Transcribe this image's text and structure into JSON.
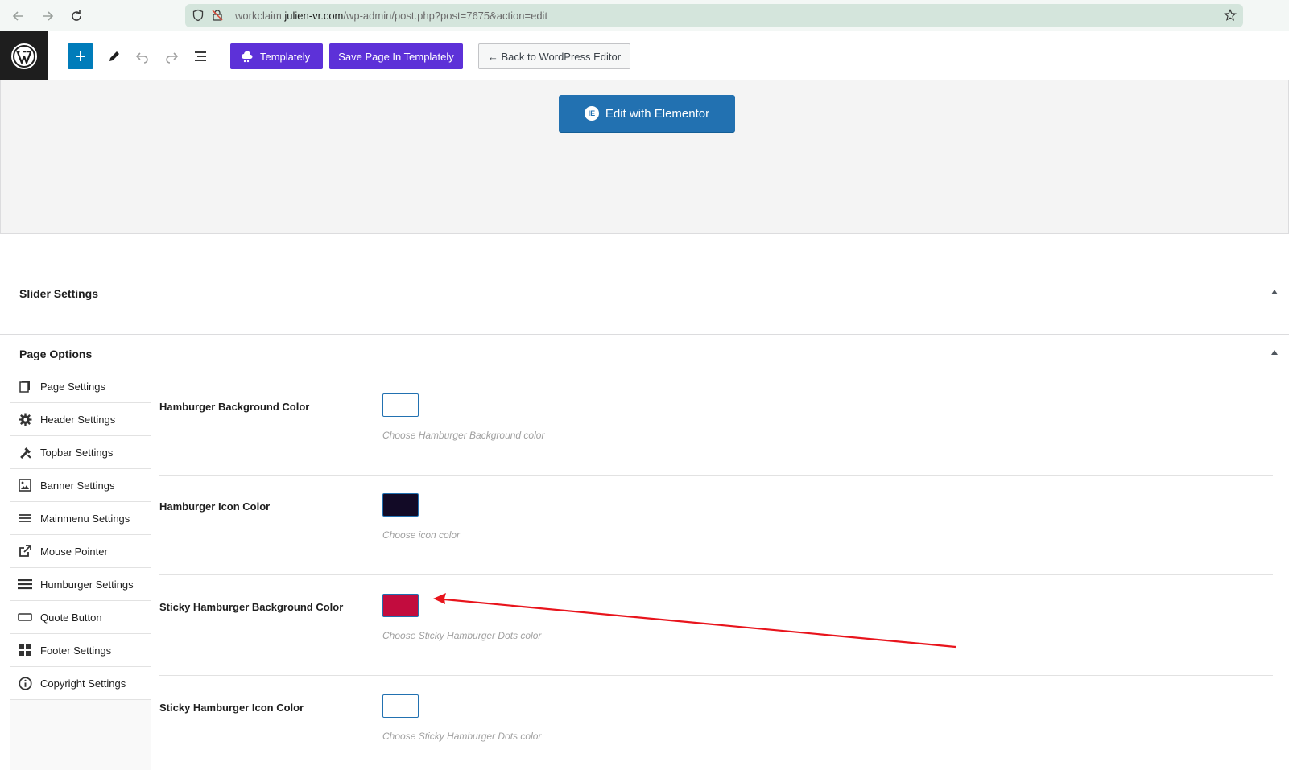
{
  "browser": {
    "url_prefix": "workclaim.",
    "url_host": "julien-vr.com",
    "url_path": "/wp-admin/post.php?post=7675&action=edit"
  },
  "toolbar": {
    "templately_label": "Templately",
    "save_label": "Save Page In Templately",
    "back_label": "← Back to WordPress Editor"
  },
  "elementor": {
    "button_label": "Edit with Elementor",
    "badge": "IE"
  },
  "metaboxes": {
    "slider_title": "Slider Settings",
    "page_options_title": "Page Options"
  },
  "sidebar": {
    "items": [
      {
        "label": "Page Settings",
        "icon": "pages-icon"
      },
      {
        "label": "Header Settings",
        "icon": "gear-icon"
      },
      {
        "label": "Topbar Settings",
        "icon": "tools-icon"
      },
      {
        "label": "Banner Settings",
        "icon": "image-icon"
      },
      {
        "label": "Mainmenu Settings",
        "icon": "menu-icon"
      },
      {
        "label": "Mouse Pointer",
        "icon": "external-icon"
      },
      {
        "label": "Humburger Settings",
        "icon": "hamburger-icon"
      },
      {
        "label": "Quote Button",
        "icon": "button-icon"
      },
      {
        "label": "Footer Settings",
        "icon": "grid-icon"
      },
      {
        "label": "Copyright Settings",
        "icon": "info-icon"
      }
    ]
  },
  "fields": [
    {
      "label": "Hamburger Background Color",
      "description": "Choose Hamburger Background color",
      "color": "#ffffff"
    },
    {
      "label": "Hamburger Icon Color",
      "description": "Choose icon color",
      "color": "#120a26"
    },
    {
      "label": "Sticky Hamburger Background Color",
      "description": "Choose Sticky Hamburger Dots color",
      "color": "#c20c3e"
    },
    {
      "label": "Sticky Hamburger Icon Color",
      "description": "Choose Sticky Hamburger Dots color",
      "color": "#ffffff"
    }
  ],
  "colors": {
    "wp_dark": "#1e1e1e",
    "wp_blue": "#007cba",
    "templately_purple": "#5d31d8",
    "annotation_arrow": "#e8141c"
  }
}
